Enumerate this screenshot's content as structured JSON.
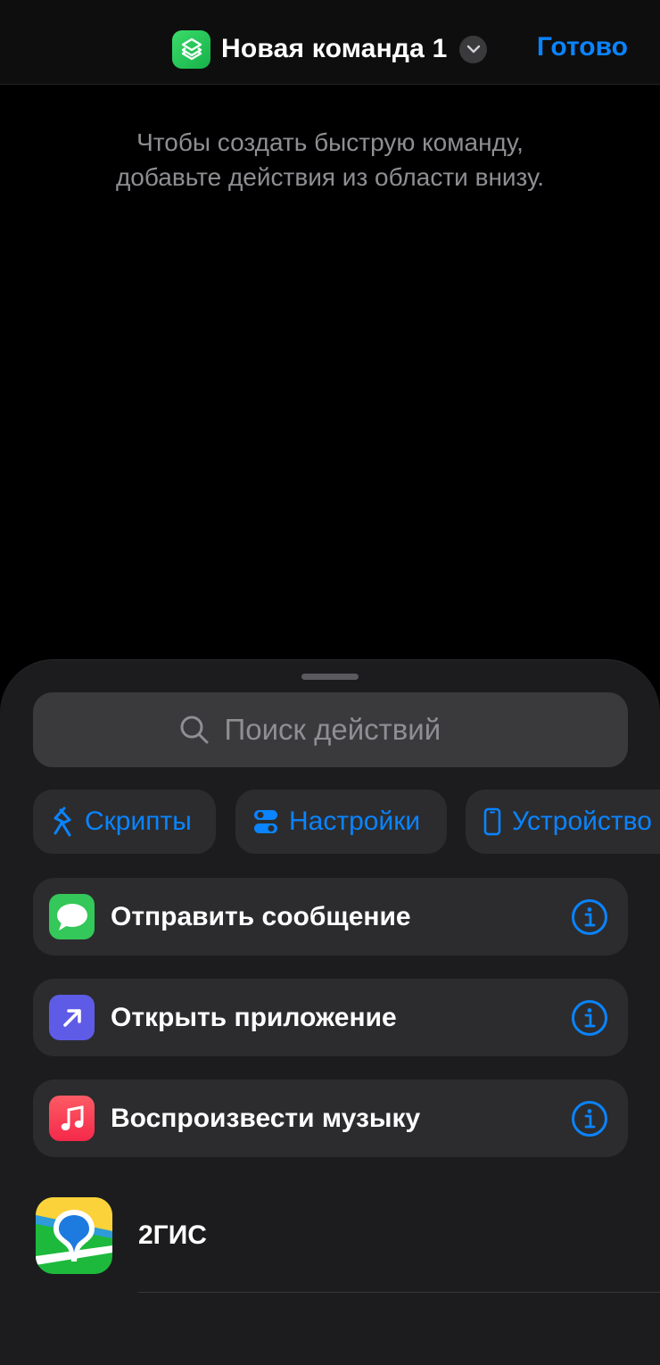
{
  "header": {
    "title": "Новая команда 1",
    "done_label": "Готово",
    "app_icon": "shortcuts-stack-icon",
    "accent_color": "#0a84ff"
  },
  "empty_hint": {
    "line1": "Чтобы создать быструю команду,",
    "line2": "добавьте действия из области внизу."
  },
  "sheet": {
    "search": {
      "placeholder": "Поиск действий",
      "value": ""
    },
    "categories": [
      {
        "label": "Скрипты",
        "icon": "scripting-icon"
      },
      {
        "label": "Настройки",
        "icon": "toggles-icon"
      },
      {
        "label": "Устройство",
        "icon": "phone-icon"
      }
    ],
    "actions": [
      {
        "label": "Отправить сообщение",
        "icon": "messages-icon",
        "color": "#34c759"
      },
      {
        "label": "Открыть приложение",
        "icon": "open-app-arrow-icon",
        "color": "#5e5ce6"
      },
      {
        "label": "Воспроизвести музыку",
        "icon": "music-note-icon",
        "color": "#fc3c44"
      }
    ],
    "apps": [
      {
        "name": "2ГИС",
        "icon": "2gis-icon"
      }
    ]
  }
}
